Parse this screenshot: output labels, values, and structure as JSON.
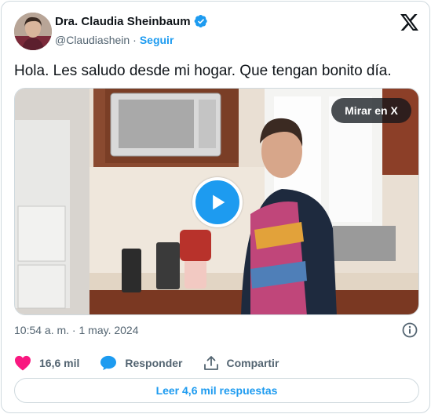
{
  "author": {
    "name": "Dra. Claudia Sheinbaum",
    "handle": "@Claudiashein",
    "separator": "·",
    "follow_label": "Seguir",
    "avatar_icon": "profile-photo",
    "verified_icon": "verified-badge-icon"
  },
  "brand": {
    "logo_icon": "x-logo-icon"
  },
  "tweet": {
    "text": "Hola. Les saludo desde mi hogar. Que tengan bonito día.",
    "timestamp": "10:54 a. m. · 1 may. 2024"
  },
  "media": {
    "watch_label": "Mirar en X",
    "play_icon": "play-icon"
  },
  "actions": {
    "likes_count": "16,6 mil",
    "reply_label": "Responder",
    "share_label": "Compartir"
  },
  "footer": {
    "read_replies_label": "Leer 4,6 mil respuestas"
  },
  "colors": {
    "accent": "#1d9bf0",
    "like": "#f91880",
    "text": "#0f1419",
    "muted": "#536471",
    "border": "#cfd9de"
  }
}
